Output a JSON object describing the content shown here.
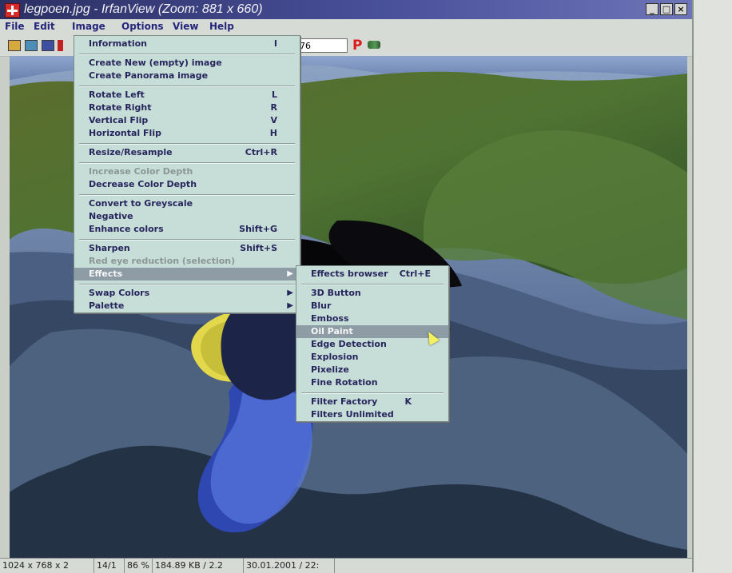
{
  "window": {
    "title": "legpoen.jpg - IrfanView (Zoom: 881 x 660)",
    "buttons": [
      "_",
      "□",
      "×"
    ]
  },
  "menubar": {
    "items": [
      "File",
      "Edit",
      "Image",
      "Options",
      "View",
      "Help"
    ]
  },
  "toolbar": {
    "zoom_value": "76",
    "icons": [
      "open-folder-icon",
      "thumbnail-icon",
      "save-icon",
      "delete-icon",
      "paint-icon",
      "plugin-icon"
    ]
  },
  "image_menu": {
    "items": [
      {
        "label": "Information",
        "shortcut": "I"
      },
      {
        "label": "Create New (empty) image",
        "shortcut": ""
      },
      {
        "label": "Create Panorama image",
        "shortcut": ""
      },
      {
        "label": "Rotate Left",
        "shortcut": "L"
      },
      {
        "label": "Rotate Right",
        "shortcut": "R"
      },
      {
        "label": "Vertical Flip",
        "shortcut": "V"
      },
      {
        "label": "Horizontal Flip",
        "shortcut": "H"
      },
      {
        "label": "Resize/Resample",
        "shortcut": "Ctrl+R"
      },
      {
        "label": "Increase Color Depth",
        "shortcut": ""
      },
      {
        "label": "Decrease Color Depth",
        "shortcut": ""
      },
      {
        "label": "Convert to Greyscale",
        "shortcut": ""
      },
      {
        "label": "Negative",
        "shortcut": ""
      },
      {
        "label": "Enhance colors",
        "shortcut": "Shift+G"
      },
      {
        "label": "Sharpen",
        "shortcut": "Shift+S"
      },
      {
        "label": "Red eye reduction (selection)",
        "shortcut": ""
      },
      {
        "label": "Effects",
        "shortcut": ""
      },
      {
        "label": "Swap Colors",
        "shortcut": ""
      },
      {
        "label": "Palette",
        "shortcut": ""
      }
    ]
  },
  "effects_menu": {
    "items": [
      {
        "label": "Effects browser",
        "shortcut": "Ctrl+E"
      },
      {
        "label": "3D Button",
        "shortcut": ""
      },
      {
        "label": "Blur",
        "shortcut": ""
      },
      {
        "label": "Emboss",
        "shortcut": ""
      },
      {
        "label": "Oil Paint",
        "shortcut": ""
      },
      {
        "label": "Edge Detection",
        "shortcut": ""
      },
      {
        "label": "Explosion",
        "shortcut": ""
      },
      {
        "label": "Pixelize",
        "shortcut": ""
      },
      {
        "label": "Fine Rotation",
        "shortcut": ""
      },
      {
        "label": "Filter Factory",
        "shortcut": "K"
      },
      {
        "label": "Filters Unlimited",
        "shortcut": ""
      }
    ]
  },
  "statusbar": {
    "segments": [
      "1024 x 768 x 2",
      "14/1",
      "86 %",
      "184.89 KB / 2.2",
      "30.01.2001 / 22:"
    ]
  }
}
